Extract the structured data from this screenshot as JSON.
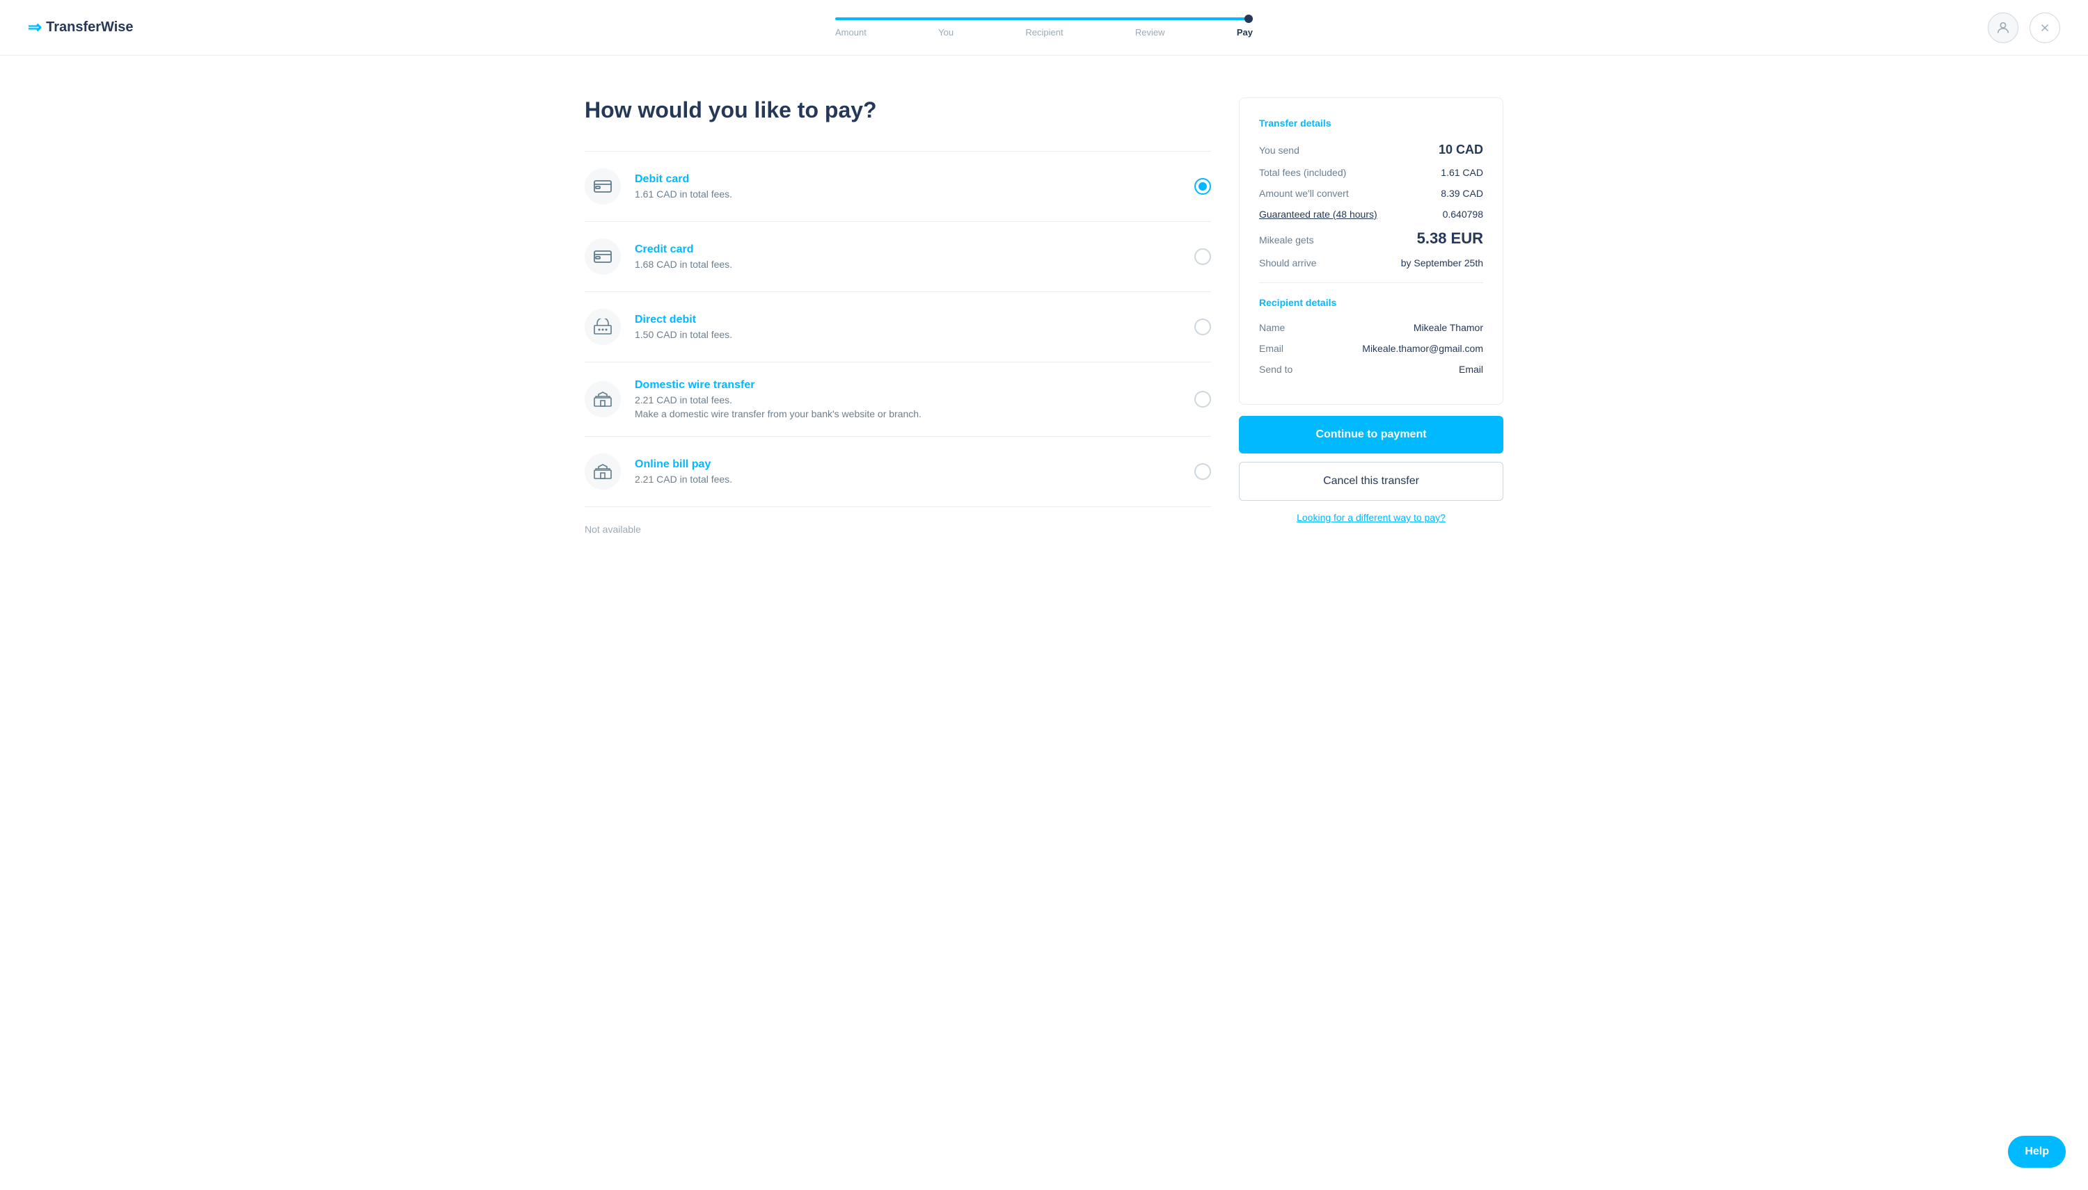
{
  "header": {
    "logo_text": "TransferWise",
    "logo_icon": "≈"
  },
  "progress": {
    "steps": [
      "Amount",
      "You",
      "Recipient",
      "Review",
      "Pay"
    ],
    "active_step": "Pay",
    "fill_percent": "100%"
  },
  "page": {
    "title": "How would you like to pay?"
  },
  "payment_options": [
    {
      "id": "debit",
      "name": "Debit card",
      "fee": "1.61 CAD in total fees.",
      "desc": "",
      "selected": true,
      "icon": "💳"
    },
    {
      "id": "credit",
      "name": "Credit card",
      "fee": "1.68 CAD in total fees.",
      "desc": "",
      "selected": false,
      "icon": "💳"
    },
    {
      "id": "direct",
      "name": "Direct debit",
      "fee": "1.50 CAD in total fees.",
      "desc": "",
      "selected": false,
      "icon": "🏦"
    },
    {
      "id": "wire",
      "name": "Domestic wire transfer",
      "fee": "2.21 CAD in total fees.",
      "desc": "Make a domestic wire transfer from your bank's website or branch.",
      "selected": false,
      "icon": "🏛"
    },
    {
      "id": "billpay",
      "name": "Online bill pay",
      "fee": "2.21 CAD in total fees.",
      "desc": "",
      "selected": false,
      "icon": "🏛"
    }
  ],
  "not_available_label": "Not available",
  "transfer_details": {
    "section_title": "Transfer details",
    "rows": [
      {
        "label": "You send",
        "value": "10 CAD",
        "size": "large"
      },
      {
        "label": "Total fees (included)",
        "value": "1.61 CAD",
        "size": "normal"
      },
      {
        "label": "Amount we'll convert",
        "value": "8.39 CAD",
        "size": "normal"
      },
      {
        "label": "Guaranteed rate (48 hours)",
        "value": "0.640798",
        "size": "normal",
        "label_link": true
      },
      {
        "label": "Mikeale gets",
        "value": "5.38 EUR",
        "size": "xlarge"
      },
      {
        "label": "Should arrive",
        "value": "by September 25th",
        "size": "normal"
      }
    ]
  },
  "recipient_details": {
    "section_title": "Recipient details",
    "rows": [
      {
        "label": "Name",
        "value": "Mikeale Thamor"
      },
      {
        "label": "Email",
        "value": "Mikeale.thamor@gmail.com"
      },
      {
        "label": "Send to",
        "value": "Email"
      }
    ]
  },
  "buttons": {
    "continue": "Continue to payment",
    "cancel": "Cancel this transfer",
    "different_way": "Looking for a different way to pay?",
    "help": "Help"
  }
}
